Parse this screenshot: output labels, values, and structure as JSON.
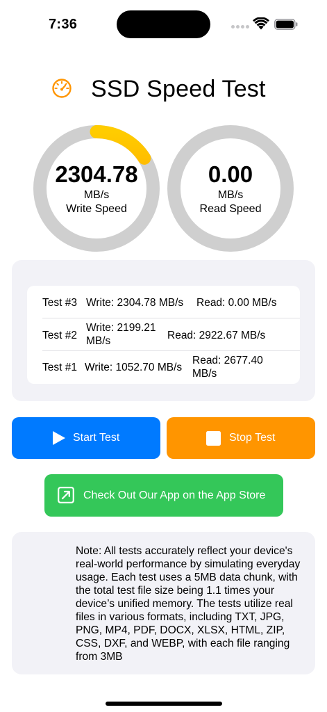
{
  "status_bar": {
    "time": "7:36"
  },
  "header": {
    "title": "SSD Speed Test",
    "icon": "speedometer-icon"
  },
  "colors": {
    "accent_orange": "#ff9500",
    "gauge_start": "#ff9500",
    "gauge_end": "#ffcc00",
    "gauge_track": "#cfcfcf",
    "primary_blue": "#007aff",
    "store_green": "#34c759",
    "panel_gray": "#f2f2f7"
  },
  "gauges": {
    "write": {
      "value": "2304.78",
      "unit": "MB/s",
      "label": "Write Speed",
      "progress": 0.16
    },
    "read": {
      "value": "0.00",
      "unit": "MB/s",
      "label": "Read Speed",
      "progress": 0
    }
  },
  "results": [
    {
      "test": "Test #3",
      "write": "Write: 2304.78 MB/s",
      "read": "Read: 0.00 MB/s"
    },
    {
      "test": "Test #2",
      "write": "Write: 2199.21 MB/s",
      "read": "Read: 2922.67 MB/s"
    },
    {
      "test": "Test #1",
      "write": "Write: 1052.70 MB/s",
      "read": "Read: 2677.40 MB/s"
    }
  ],
  "buttons": {
    "start": {
      "label": "Start Test",
      "icon": "play-icon"
    },
    "stop": {
      "label": "Stop Test",
      "icon": "stop-icon"
    },
    "store": {
      "label": "Check Out Our App on the App Store",
      "icon": "external-link-icon"
    }
  },
  "note": {
    "text": "Note: All tests accurately reflect your device's real-world performance by simulating everyday usage. Each test uses a 5MB data chunk, with the total test file size being 1.1 times your device’s unified memory. The tests utilize real files in various formats, including TXT, JPG, PNG, MP4, PDF, DOCX, XLSX, HTML, ZIP, CSS, DXF, and WEBP, with each file ranging from 3MB"
  }
}
